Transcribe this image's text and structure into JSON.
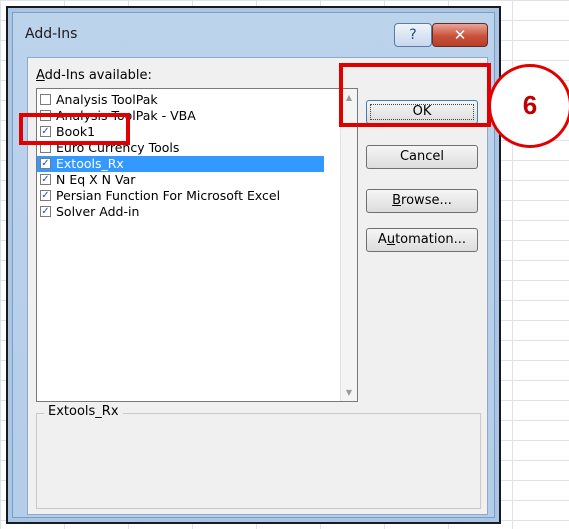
{
  "dialog": {
    "title": "Add-Ins",
    "help_glyph": "?",
    "close_glyph": "✕",
    "available_label_prefix": "A",
    "available_label_rest": "dd-Ins available:"
  },
  "addins": [
    {
      "label": "Analysis ToolPak",
      "checked": false,
      "selected": false
    },
    {
      "label": "Analysis ToolPak - VBA",
      "checked": false,
      "selected": false
    },
    {
      "label": "Book1",
      "checked": true,
      "selected": false
    },
    {
      "label": "Euro Currency Tools",
      "checked": false,
      "selected": false
    },
    {
      "label": "Extools_Rx",
      "checked": true,
      "selected": true
    },
    {
      "label": "N Eq X N Var",
      "checked": true,
      "selected": false
    },
    {
      "label": "Persian Function For Microsoft Excel",
      "checked": true,
      "selected": false
    },
    {
      "label": "Solver Add-in",
      "checked": true,
      "selected": false
    }
  ],
  "buttons": {
    "ok": "OK",
    "cancel": "Cancel",
    "browse_prefix": "B",
    "browse_rest": "rowse...",
    "automation_prefix": "A",
    "automation_u": "u",
    "automation_rest": "tomation..."
  },
  "description": {
    "title": "Extools_Rx"
  },
  "annotation": {
    "step_number": "6",
    "color": "#e00000"
  },
  "colors": {
    "selection": "#3399ff",
    "window_frame": "#b4cde8"
  }
}
